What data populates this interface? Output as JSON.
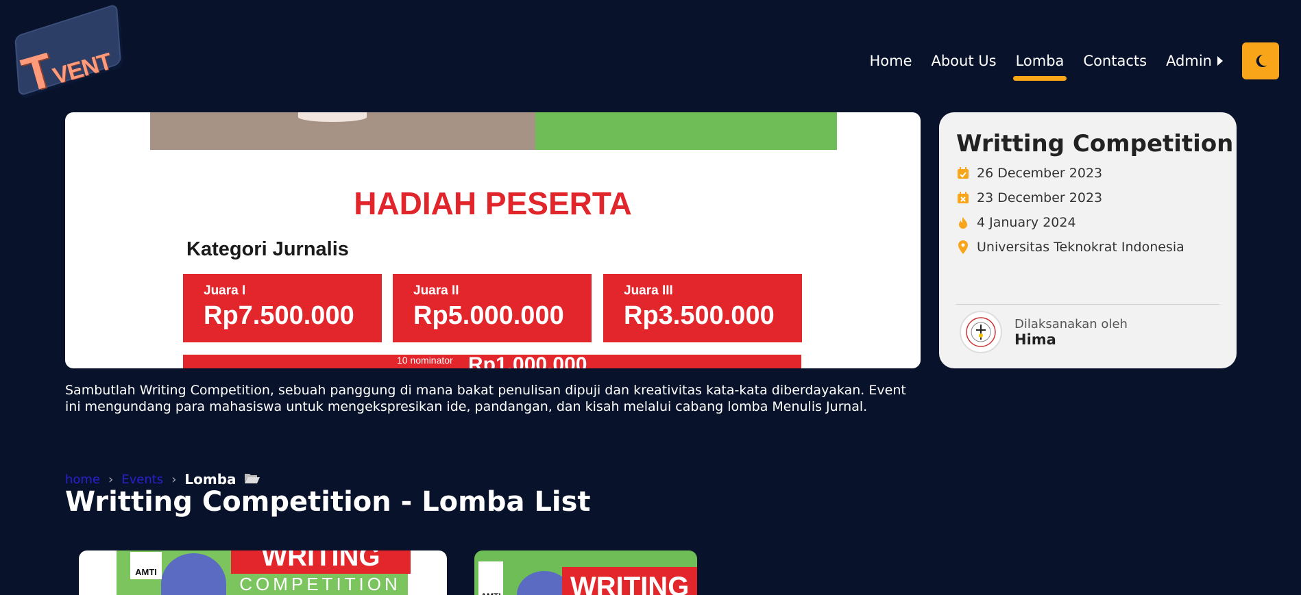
{
  "logo": {
    "text_t": "T",
    "text_vent": "VENT"
  },
  "nav": {
    "items": [
      {
        "label": "Home",
        "active": false
      },
      {
        "label": "About Us",
        "active": false
      },
      {
        "label": "Lomba",
        "active": true
      },
      {
        "label": "Contacts",
        "active": false
      },
      {
        "label": "Admin",
        "active": false
      }
    ],
    "theme_toggle_icon": "moon-icon",
    "accent_color": "#f9a51a"
  },
  "hero": {
    "title": "HADIAH PESERTA",
    "category": "Kategori Jurnalis",
    "prizes": [
      {
        "rank": "Juara I",
        "amount": "Rp7.500.000"
      },
      {
        "rank": "Juara II",
        "amount": "Rp5.000.000"
      },
      {
        "rank": "Juara III",
        "amount": "Rp3.500.000"
      }
    ],
    "nominator_label": "10 nominator",
    "nominator_amount": "Rp1.000.000"
  },
  "info": {
    "title": "Writting Competition",
    "rows": [
      {
        "icon": "calendar-check-icon",
        "text": "26 December 2023"
      },
      {
        "icon": "calendar-x-icon",
        "text": "23 December 2023"
      },
      {
        "icon": "fire-icon",
        "text": "4 January 2024"
      },
      {
        "icon": "location-pin-icon",
        "text": "Universitas Teknokrat Indonesia"
      }
    ],
    "organizer_label": "Dilaksanakan oleh",
    "organizer_name": "Hima"
  },
  "description": "Sambutlah Writing Competition, sebuah panggung di mana bakat penulisan dipuji dan kreativitas kata-kata diberdayakan. Event ini mengundang para mahasiswa untuk mengekspresikan ide, pandangan, dan kisah melalui cabang lomba Menulis Jurnal.",
  "breadcrumb": {
    "home": "home",
    "events": "Events",
    "current": "Lomba"
  },
  "page_title": "Writting Competition - Lomba List",
  "cards": [
    {
      "logo_text": "AMTI",
      "heading": "WRITING",
      "subheading": "COMPETITION"
    },
    {
      "logo_text": "AMTI",
      "heading": "WRITING"
    }
  ]
}
